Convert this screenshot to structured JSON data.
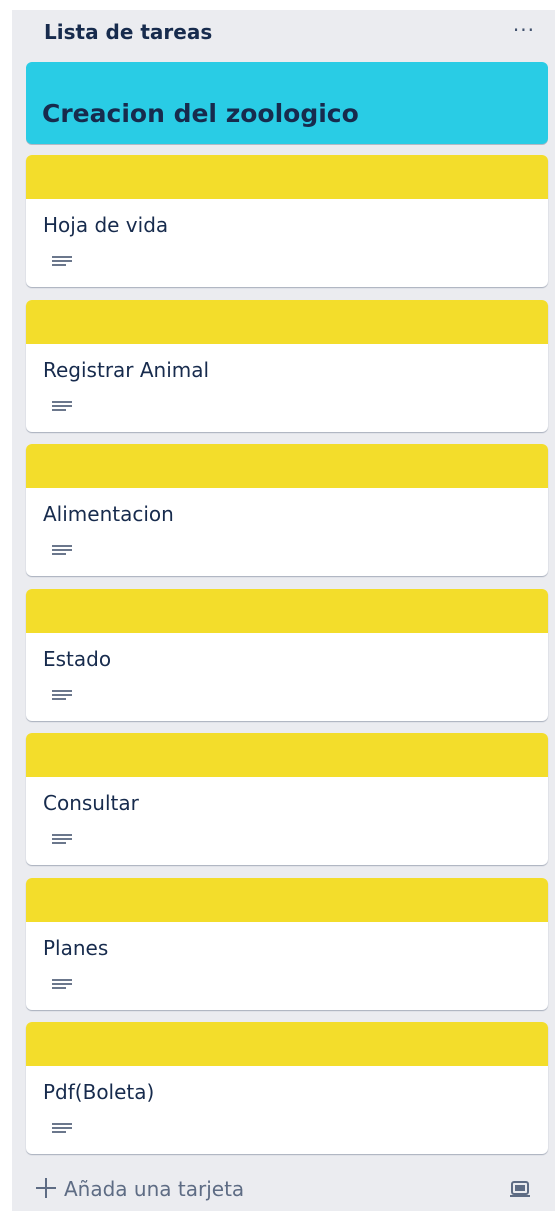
{
  "list": {
    "title": "Lista de tareas",
    "menu_label": "···",
    "background": "#ebecf0"
  },
  "cover_card": {
    "title": "Creacion del zoologico",
    "color": "#29cce5"
  },
  "cards": [
    {
      "title": "Hoja de vida",
      "cover_color": "#f3dd2b",
      "has_description": true
    },
    {
      "title": "Registrar Animal",
      "cover_color": "#f3dd2b",
      "has_description": true
    },
    {
      "title": "Alimentacion",
      "cover_color": "#f3dd2b",
      "has_description": true
    },
    {
      "title": "Estado",
      "cover_color": "#f3dd2b",
      "has_description": true
    },
    {
      "title": "Consultar",
      "cover_color": "#f3dd2b",
      "has_description": true
    },
    {
      "title": "Planes",
      "cover_color": "#f3dd2b",
      "has_description": true
    },
    {
      "title": "Pdf(Boleta)",
      "cover_color": "#f3dd2b",
      "has_description": true
    }
  ],
  "footer": {
    "add_card_label": "Añada una tarjeta",
    "add_icon": "plus-icon",
    "template_icon": "card-template-icon"
  }
}
